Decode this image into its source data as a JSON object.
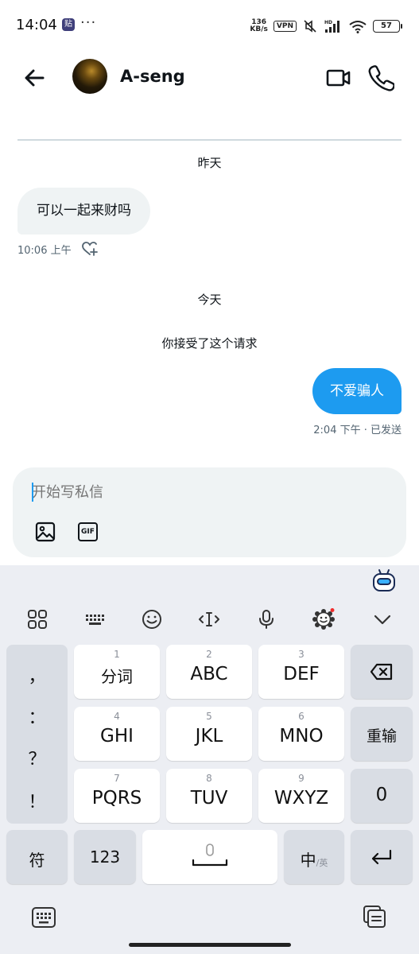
{
  "status_bar": {
    "time": "14:04",
    "app_badge": "贴",
    "more": "···",
    "net_speed_value": "136",
    "net_speed_unit": "KB/s",
    "vpn": "VPN",
    "signal_hd": "HD",
    "battery": "57"
  },
  "header": {
    "contact_name": "A-seng",
    "icons": [
      "back-arrow-icon",
      "video-camera-icon",
      "phone-icon"
    ]
  },
  "conversation": {
    "yesterday_label": "昨天",
    "incoming_message": "可以一起来财吗",
    "incoming_time": "10:06 上午",
    "today_label": "今天",
    "system_note": "你接受了这个请求",
    "outgoing_message": "不爱骗人",
    "outgoing_meta": "2:04 下午 · 已发送"
  },
  "composer": {
    "placeholder": "开始写私信",
    "gif_label": "GIF"
  },
  "keyboard": {
    "toolbar_icons": [
      "apps-grid-icon",
      "keyboard-layout-icon",
      "emoji-icon",
      "cursor-move-icon",
      "microphone-icon",
      "skin-theme-icon",
      "collapse-chevron-icon"
    ],
    "side_punctuation": [
      "，",
      "：",
      "？",
      "！"
    ],
    "keys": {
      "k1": {
        "num": "1",
        "label": "分词"
      },
      "k2": {
        "num": "2",
        "label": "ABC"
      },
      "k3": {
        "num": "3",
        "label": "DEF"
      },
      "k4": {
        "num": "4",
        "label": "GHI"
      },
      "k5": {
        "num": "5",
        "label": "JKL"
      },
      "k6": {
        "num": "6",
        "label": "MNO"
      },
      "k7": {
        "num": "7",
        "label": "PQRS"
      },
      "k8": {
        "num": "8",
        "label": "TUV"
      },
      "k9": {
        "num": "9",
        "label": "WXYZ"
      },
      "reenter": "重输",
      "zero": "0",
      "symbols": "符",
      "numbers": "123",
      "lang_main": "中",
      "lang_alt": "/英"
    },
    "accent_color": "#1d9bf0"
  }
}
